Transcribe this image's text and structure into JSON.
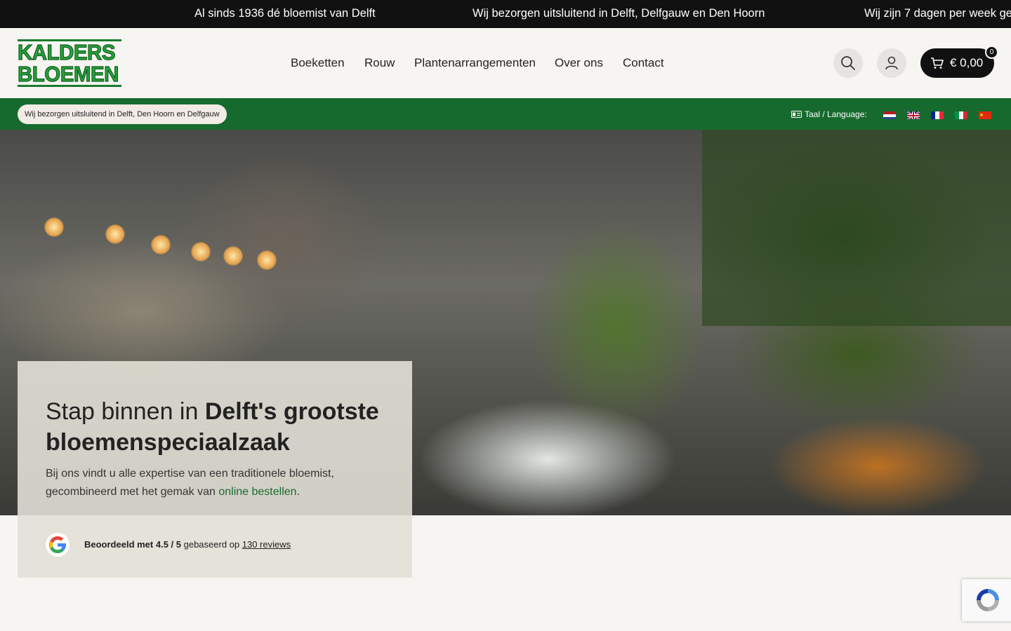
{
  "announcements": [
    "Al sinds 1936 dé bloemist van Delft",
    "Wij bezorgen uitsluitend in Delft, Delfgauw en Den Hoorn",
    "Wij zijn 7 dagen per week ge"
  ],
  "logo": {
    "line1": "KALDERS",
    "line2": "BLOEMEN"
  },
  "nav": [
    "Boeketten",
    "Rouw",
    "Plantenarrangementen",
    "Over ons",
    "Contact"
  ],
  "cart": {
    "total": "€ 0,00",
    "count": "0"
  },
  "delivery_pill": "Wij bezorgen uitsluitend in Delft, Den Hoorn en Delfgauw",
  "language": {
    "label": "Taal / Language:",
    "flags": [
      "nl-flag-icon",
      "uk-flag-icon",
      "fr-flag-icon",
      "it-flag-icon",
      "cn-flag-icon"
    ]
  },
  "hero": {
    "title_regular": "Stap binnen in ",
    "title_bold": "Delft's grootste bloemenspeciaalzaak",
    "text_before": "Bij ons vindt u alle expertise van een traditionele bloemist, gecombineerd met het gemak van ",
    "text_link": "online bestellen",
    "text_after": "."
  },
  "review": {
    "prefix": "Beoordeeld met 4.5 / 5",
    "middle": " gebaseerd op ",
    "link": "130 reviews"
  },
  "colors": {
    "brand_green": "#176a2e",
    "topbar": "#111111",
    "background": "#f7f5f1"
  }
}
